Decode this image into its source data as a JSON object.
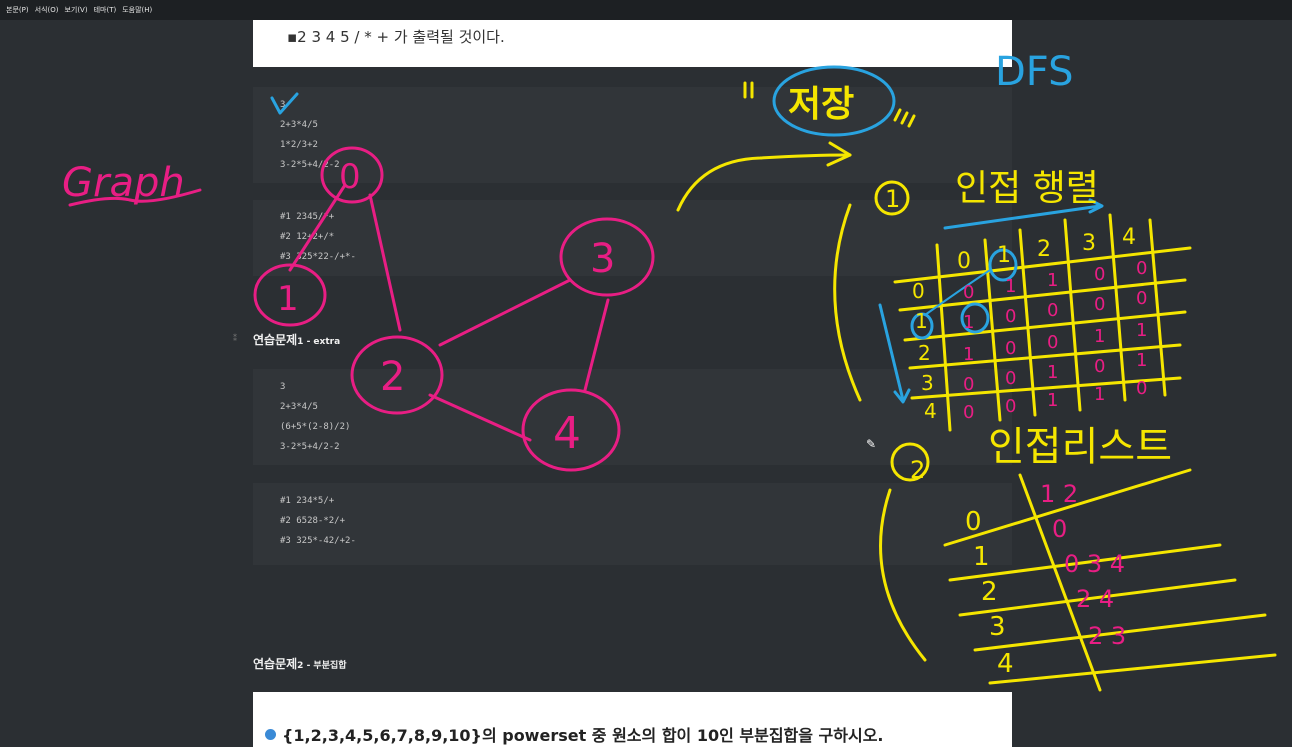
{
  "menubar": {
    "items": [
      "본문(P)",
      "서식(O)",
      "보기(V)",
      "테마(T)",
      "도움말(H)"
    ]
  },
  "doc": {
    "bullet_text": "2 3 4 5 / * + 가 출력될 것이다.",
    "code1": [
      "3",
      "2+3*4/5",
      "1*2/3+2",
      "3-2*5+4/2-2"
    ],
    "code2": [
      "#1 2345/*+",
      "#2 12+2+/*",
      "#3 325*22-/+*-"
    ],
    "heading1": "연습문제",
    "heading1_small": "1 - extra",
    "code3": [
      "3",
      "2+3*4/5",
      "(6+5*(2-8)/2)",
      "3-2*5+4/2-2"
    ],
    "code4": [
      "#1 234*5/+",
      "#2 6528-*2/+",
      "#3 325*-42/+2-"
    ],
    "heading2": "연습문제",
    "heading2_small": "2 - 부분집합",
    "question": "{1,2,3,4,5,6,7,8,9,10}의 powerset 중 원소의 합이 10인 부분집합을 구하시오."
  },
  "ink_colors": {
    "pink": "#e81e84",
    "yellow": "#f5e600",
    "blue": "#29a3e0"
  },
  "annotations": {
    "graph_label": "Graph",
    "graph_nodes": [
      "0",
      "1",
      "2",
      "3",
      "4"
    ],
    "save_label": "저장",
    "dfs_label": "DFS",
    "matrix_marker": "1",
    "matrix_title": "인접 행렬",
    "matrix_col_headers": [
      "0",
      "1",
      "2",
      "3",
      "4"
    ],
    "matrix_row_headers": [
      "0",
      "1",
      "2",
      "3",
      "4"
    ],
    "matrix_rows": [
      [
        "0",
        "1",
        "1",
        "0",
        "0"
      ],
      [
        "1",
        "0",
        "0",
        "0",
        "0"
      ],
      [
        "1",
        "0",
        "0",
        "1",
        "1"
      ],
      [
        "0",
        "0",
        "1",
        "0",
        "1"
      ],
      [
        "0",
        "0",
        "1",
        "1",
        "0"
      ]
    ],
    "list_marker": "2",
    "list_title": "인접리스트",
    "list_rows": [
      {
        "node": "0",
        "adj": "1 2"
      },
      {
        "node": "1",
        "adj": "0"
      },
      {
        "node": "2",
        "adj": "0 3 4"
      },
      {
        "node": "3",
        "adj": "2 4"
      },
      {
        "node": "4",
        "adj": "2 3"
      }
    ]
  }
}
